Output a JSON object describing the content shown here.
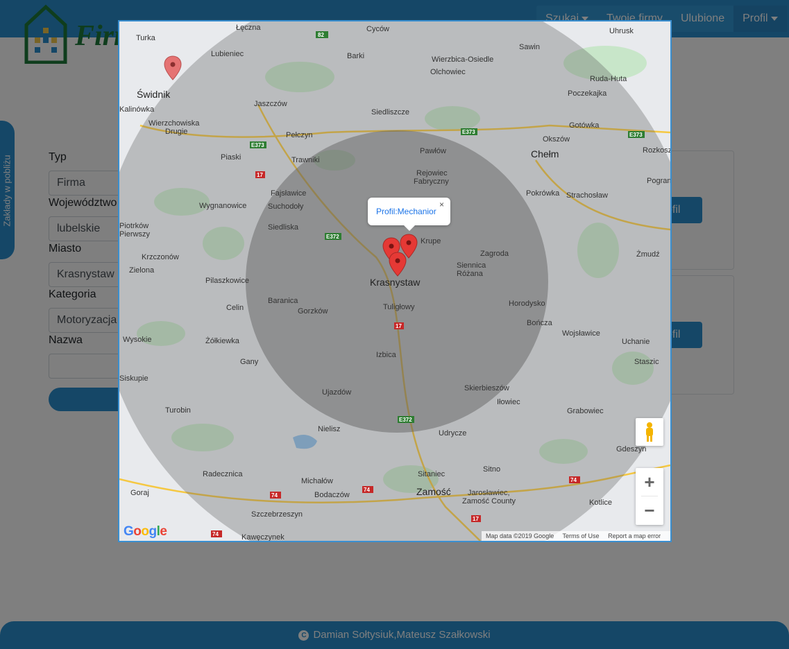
{
  "navbar": {
    "brand": "Firma",
    "menu": [
      {
        "label": "Szukaj",
        "has_caret": true
      },
      {
        "label": "Twoje firmy",
        "has_caret": false
      },
      {
        "label": "Ulubione",
        "has_caret": false
      },
      {
        "label": "Profil",
        "has_caret": true
      }
    ]
  },
  "side_tab": {
    "label": "Zakłady w pobliżu"
  },
  "form": {
    "fields": [
      {
        "label": "Typ",
        "value": "Firma"
      },
      {
        "label": "Województwo",
        "value": "lubelskie"
      },
      {
        "label": "Miasto",
        "value": "Krasnystaw"
      },
      {
        "label": "Kategoria",
        "value": "Motoryzacja"
      },
      {
        "label": "Nazwa",
        "value": ""
      }
    ]
  },
  "cards": [
    {
      "button_label": "ofil"
    },
    {
      "button_label": "ofil"
    }
  ],
  "footer": {
    "text": "Damian Sołtysiuk,Mateusz Szałkowski"
  },
  "map": {
    "info_window": {
      "text": "Profil:Mechanior",
      "close": "×"
    },
    "places": [
      {
        "name": "Turka"
      },
      {
        "name": "Łęczna"
      },
      {
        "name": "Cyców"
      },
      {
        "name": "Uhrusk"
      },
      {
        "name": "Lubieniec"
      },
      {
        "name": "Barki"
      },
      {
        "name": "Wierzbica-Osiedle"
      },
      {
        "name": "Sawin"
      },
      {
        "name": "Olchowiec"
      },
      {
        "name": "Świdnik"
      },
      {
        "name": "Ruda-Huta"
      },
      {
        "name": "Poczekajka"
      },
      {
        "name": "Kalinówka"
      },
      {
        "name": "Jaszczów"
      },
      {
        "name": "Siedliszcze"
      },
      {
        "name": "Wierzchowiska"
      },
      {
        "name": "Drugie"
      },
      {
        "name": "Gotówka"
      },
      {
        "name": "Pełczyn"
      },
      {
        "name": "Okszów"
      },
      {
        "name": "Pawłów"
      },
      {
        "name": "Piaski"
      },
      {
        "name": "Trawniki"
      },
      {
        "name": "Chełm"
      },
      {
        "name": "Rozkosz"
      },
      {
        "name": "Rejowiec"
      },
      {
        "name": "Fabryczny"
      },
      {
        "name": "Pokrówka"
      },
      {
        "name": "Strachosław"
      },
      {
        "name": "Fajsławice"
      },
      {
        "name": "Pogranicze"
      },
      {
        "name": "Wygnanowice"
      },
      {
        "name": "Suchodoły"
      },
      {
        "name": "Piotrków"
      },
      {
        "name": "Pierwszy"
      },
      {
        "name": "Siedliska"
      },
      {
        "name": "Krupe"
      },
      {
        "name": "Żmudź"
      },
      {
        "name": "Krzczonów"
      },
      {
        "name": "Zagroda"
      },
      {
        "name": "Siennica"
      },
      {
        "name": "Różana"
      },
      {
        "name": "Zielona"
      },
      {
        "name": "Pilaszkowice"
      },
      {
        "name": "Krasnystaw"
      },
      {
        "name": "Baranica"
      },
      {
        "name": "Tuligłowy"
      },
      {
        "name": "Horodysko"
      },
      {
        "name": "Celin"
      },
      {
        "name": "Gorzków"
      },
      {
        "name": "Bończa"
      },
      {
        "name": "Wysokie"
      },
      {
        "name": "Żółkiewka"
      },
      {
        "name": "Wojsławice"
      },
      {
        "name": "Uchanie"
      },
      {
        "name": "Izbica"
      },
      {
        "name": "Gany"
      },
      {
        "name": "Staszic"
      },
      {
        "name": "Siskupie"
      },
      {
        "name": "Ujazdów"
      },
      {
        "name": "Skierbieszów"
      },
      {
        "name": "Iłowiec"
      },
      {
        "name": "Turobin"
      },
      {
        "name": "Grabowiec"
      },
      {
        "name": "Nielisz"
      },
      {
        "name": "Udrycze"
      },
      {
        "name": "Gdeszyn"
      },
      {
        "name": "Sitno"
      },
      {
        "name": "Radecznica"
      },
      {
        "name": "Sitaniec"
      },
      {
        "name": "Michałów"
      },
      {
        "name": "Goraj"
      },
      {
        "name": "Bodaczów"
      },
      {
        "name": "Zamość"
      },
      {
        "name": "Jarosławiec,"
      },
      {
        "name": "Zamość County"
      },
      {
        "name": "Kotlice"
      },
      {
        "name": "Szczebrzeszyn"
      },
      {
        "name": "Kawęczynek"
      }
    ],
    "road_labels": [
      "82",
      "E373",
      "E373",
      "E373",
      "17",
      "E372",
      "17",
      "E372",
      "74",
      "74",
      "74",
      "74",
      "17"
    ],
    "google_logo": "Google",
    "attribution": [
      "Map data ©2019 Google",
      "Terms of Use",
      "Report a map error"
    ],
    "controls": {
      "zoom_in": "+",
      "zoom_out": "−"
    },
    "colors": {
      "circle": "#5a5a5a",
      "marker": "#e53935",
      "marker_faded": "#e57373",
      "road": "#f5c842",
      "water": "#8fbfe8",
      "land": "#e8eaed",
      "forest": "#c8e6c9"
    }
  }
}
